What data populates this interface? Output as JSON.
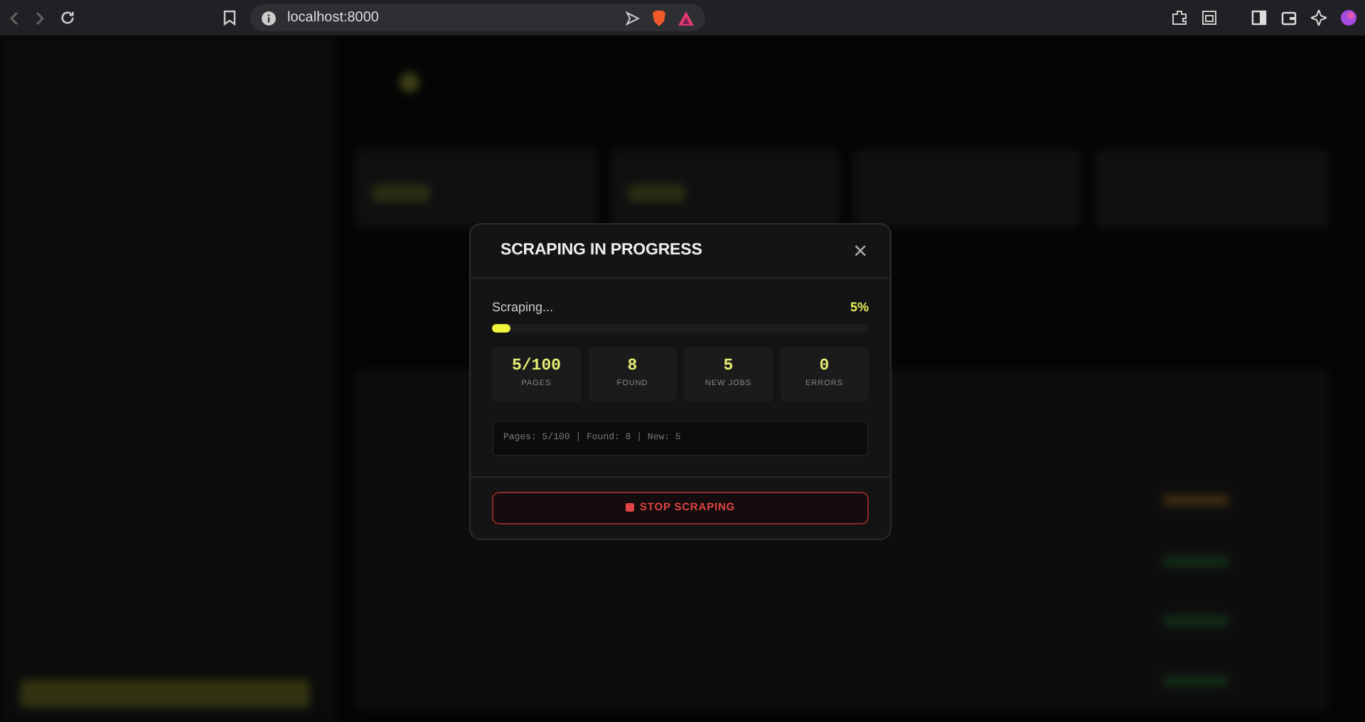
{
  "browser": {
    "url": "localhost:8000"
  },
  "dialog": {
    "title": "SCRAPING IN PROGRESS",
    "close": "×",
    "progress": {
      "label": "Scraping...",
      "percent": "5%",
      "level": 0.05
    },
    "stats": [
      {
        "value": "5/100",
        "label": "PAGES"
      },
      {
        "value": "8",
        "label": "FOUND"
      },
      {
        "value": "5",
        "label": "NEW JOBS"
      },
      {
        "value": "0",
        "label": "ERRORS"
      }
    ],
    "log": "Pages: 5/100 | Found: 8 | New: 5",
    "stop_button": "STOP SCRAPING"
  }
}
